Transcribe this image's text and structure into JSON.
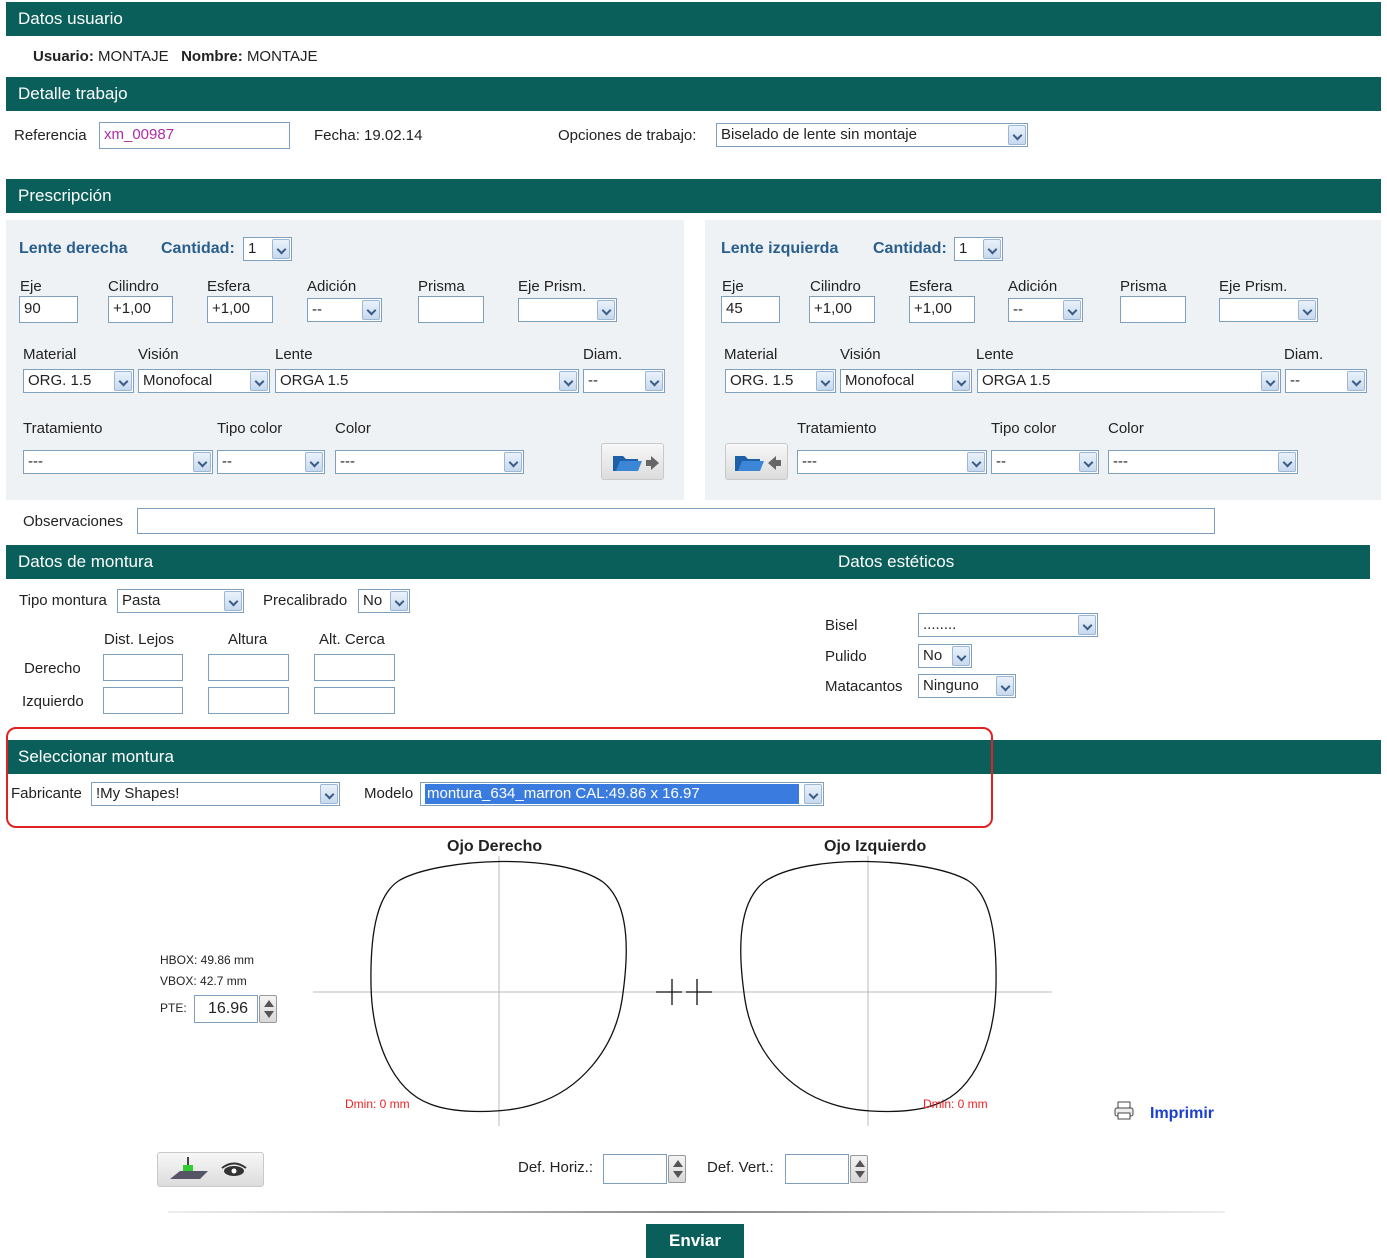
{
  "header_user": {
    "title": "Datos usuario",
    "usuario_label": "Usuario:",
    "usuario_value": "MONTAJE",
    "nombre_label": "Nombre:",
    "nombre_value": "MONTAJE"
  },
  "trabajo": {
    "title": "Detalle trabajo",
    "referencia_label": "Referencia",
    "referencia_value": "xm_00987",
    "fecha": "Fecha: 19.02.14",
    "opciones_label": "Opciones de trabajo:",
    "opciones_value": "Biselado de lente sin montaje"
  },
  "prescripcion": {
    "title": "Prescripción",
    "col_eje": "Eje",
    "col_cilindro": "Cilindro",
    "col_esfera": "Esfera",
    "col_adicion": "Adición",
    "col_prisma": "Prisma",
    "col_eje_prism": "Eje Prism.",
    "col_material": "Material",
    "col_vision": "Visión",
    "col_lente": "Lente",
    "col_diam": "Diam.",
    "col_tratamiento": "Tratamiento",
    "col_tipo_color": "Tipo color",
    "col_color": "Color",
    "cantidad_label": "Cantidad:",
    "right": {
      "title": "Lente derecha",
      "cantidad": "1",
      "eje": "90",
      "cilindro": "+1,00",
      "esfera": "+1,00",
      "adicion": "--",
      "prisma": "",
      "eje_prism": "",
      "material": "ORG. 1.5",
      "vision": "Monofocal",
      "lente": "ORGA 1.5",
      "diam": "--",
      "tratamiento": "---",
      "tipo_color": "--",
      "color": "---"
    },
    "left": {
      "title": "Lente izquierda",
      "cantidad": "1",
      "eje": "45",
      "cilindro": "+1,00",
      "esfera": "+1,00",
      "adicion": "--",
      "prisma": "",
      "eje_prism": "",
      "material": "ORG. 1.5",
      "vision": "Monofocal",
      "lente": "ORGA 1.5",
      "diam": "--",
      "tratamiento": "---",
      "tipo_color": "--",
      "color": "---"
    },
    "observaciones_label": "Observaciones",
    "observaciones_value": ""
  },
  "montura": {
    "title": "Datos de montura",
    "tipo_label": "Tipo montura",
    "tipo_value": "Pasta",
    "precalibrado_label": "Precalibrado",
    "precalibrado_value": "No",
    "dist_lejos": "Dist. Lejos",
    "altura": "Altura",
    "alt_cerca": "Alt. Cerca",
    "derecho": "Derecho",
    "izquierdo": "Izquierdo"
  },
  "esteticos": {
    "title": "Datos estéticos",
    "bisel_label": "Bisel",
    "bisel_value": "........",
    "pulido_label": "Pulido",
    "pulido_value": "No",
    "matacantos_label": "Matacantos",
    "matacantos_value": "Ninguno"
  },
  "seleccionar": {
    "title": "Seleccionar montura",
    "fabricante_label": "Fabricante",
    "fabricante_value": "!My Shapes!",
    "modelo_label": "Modelo",
    "modelo_value": "montura_634_marron CAL:49.86 x 16.97"
  },
  "shape": {
    "ojo_derecho": "Ojo Derecho",
    "ojo_izquierdo": "Ojo Izquierdo",
    "hbox": "HBOX: 49.86 mm",
    "vbox": "VBOX: 42.7 mm",
    "pte_label": "PTE:",
    "pte_value": "16.96",
    "dmin_right": "Dmin: 0 mm",
    "dmin_left": "Dmin: 0 mm",
    "imprimir": "Imprimir",
    "def_horiz_label": "Def. Horiz.:",
    "def_vert_label": "Def. Vert.:",
    "enviar": "Enviar"
  },
  "colors": {
    "bar": "#0a5f5a",
    "panel": "#eef2f4",
    "link": "#1a3fd0",
    "highlight": "#e22222",
    "selected": "#3a7be0"
  }
}
